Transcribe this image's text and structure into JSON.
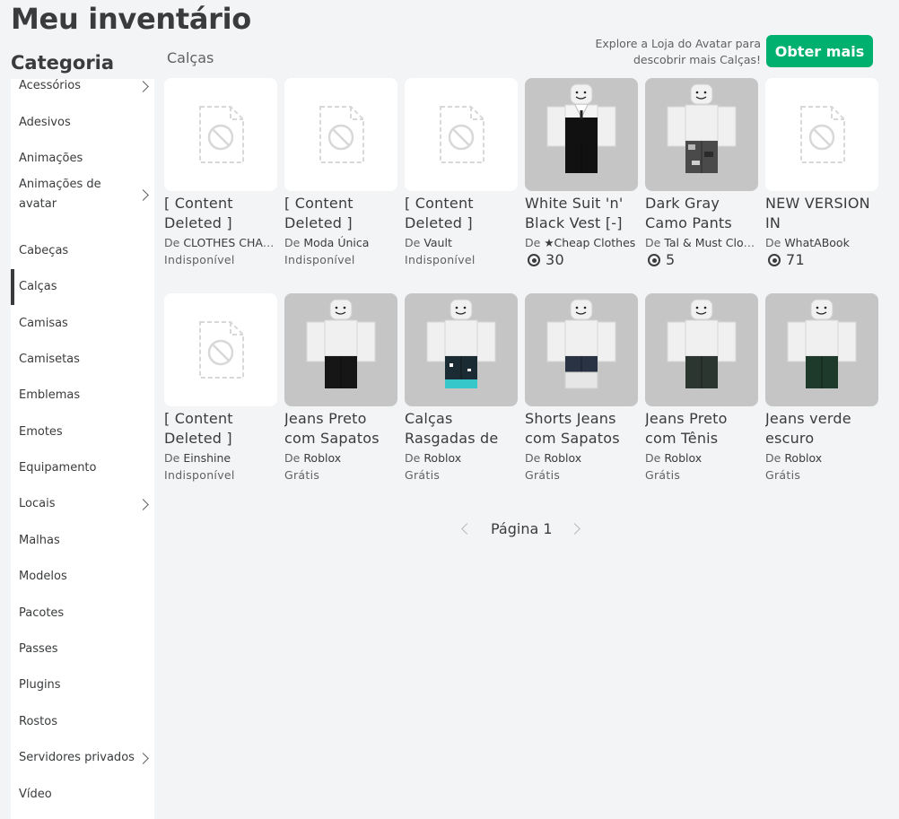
{
  "page": {
    "title": "Meu inventário",
    "category_heading": "Categoria"
  },
  "sidebar": {
    "items": [
      {
        "label": "Acessórios",
        "chevron": true,
        "active": false
      },
      {
        "label": "Adesivos",
        "chevron": false,
        "active": false
      },
      {
        "label": "Animações",
        "chevron": false,
        "active": false
      },
      {
        "label": "Animações de avatar",
        "chevron": true,
        "active": false
      },
      {
        "label": "Cabeças",
        "chevron": false,
        "active": false
      },
      {
        "label": "Calças",
        "chevron": false,
        "active": true
      },
      {
        "label": "Camisas",
        "chevron": false,
        "active": false
      },
      {
        "label": "Camisetas",
        "chevron": false,
        "active": false
      },
      {
        "label": "Emblemas",
        "chevron": false,
        "active": false
      },
      {
        "label": "Emotes",
        "chevron": false,
        "active": false
      },
      {
        "label": "Equipamento",
        "chevron": false,
        "active": false
      },
      {
        "label": "Locais",
        "chevron": true,
        "active": false
      },
      {
        "label": "Malhas",
        "chevron": false,
        "active": false
      },
      {
        "label": "Modelos",
        "chevron": false,
        "active": false
      },
      {
        "label": "Pacotes",
        "chevron": false,
        "active": false
      },
      {
        "label": "Passes",
        "chevron": false,
        "active": false
      },
      {
        "label": "Plugins",
        "chevron": false,
        "active": false
      },
      {
        "label": "Rostos",
        "chevron": false,
        "active": false
      },
      {
        "label": "Servidores privados",
        "chevron": true,
        "active": false
      },
      {
        "label": "Vídeo",
        "chevron": false,
        "active": false
      }
    ]
  },
  "main": {
    "section_label": "Calças",
    "explore_text": "Explore a Loja do Avatar para descobrir mais Calças!",
    "get_more_label": "Obter mais"
  },
  "items": [
    {
      "name": "[ Content Deleted ]",
      "by": "De",
      "creator": "CLOTHES CHAINS",
      "price": "Indisponível",
      "robux": false,
      "thumb": "deleted"
    },
    {
      "name": "[ Content Deleted ]",
      "by": "De",
      "creator": "Moda Única",
      "price": "Indisponível",
      "robux": false,
      "thumb": "deleted"
    },
    {
      "name": "[ Content Deleted ]",
      "by": "De",
      "creator": "Vault",
      "price": "Indisponível",
      "robux": false,
      "thumb": "deleted"
    },
    {
      "name": "White Suit 'n' Black Vest [-]",
      "by": "De",
      "creator": "★Cheap Clothes",
      "price": "30",
      "robux": true,
      "thumb": "suit",
      "color": "#111111"
    },
    {
      "name": "Dark Gray Camo Pants",
      "by": "De",
      "creator": "Tal & Must Clothing",
      "price": "5",
      "robux": true,
      "thumb": "pants",
      "color": "#4a4a4a"
    },
    {
      "name": "NEW VERSION IN",
      "by": "De",
      "creator": "WhatABook",
      "price": "71",
      "robux": true,
      "thumb": "deleted"
    },
    {
      "name": "[ Content Deleted ]",
      "by": "De",
      "creator": "Einshine",
      "price": "Indisponível",
      "robux": false,
      "thumb": "deleted"
    },
    {
      "name": "Jeans Preto com Sapatos",
      "by": "De",
      "creator": "Roblox",
      "price": "Grátis",
      "robux": false,
      "thumb": "pants",
      "color": "#161616"
    },
    {
      "name": "Calças Rasgadas de",
      "by": "De",
      "creator": "Roblox",
      "price": "Grátis",
      "robux": false,
      "thumb": "pants",
      "color": "#1b2b33",
      "accent": "#35c7c9"
    },
    {
      "name": "Shorts Jeans com Sapatos",
      "by": "De",
      "creator": "Roblox",
      "price": "Grátis",
      "robux": false,
      "thumb": "shorts",
      "color": "#2a3344"
    },
    {
      "name": "Jeans Preto com Tênis",
      "by": "De",
      "creator": "Roblox",
      "price": "Grátis",
      "robux": false,
      "thumb": "pants",
      "color": "#2c3630"
    },
    {
      "name": "Jeans verde escuro",
      "by": "De",
      "creator": "Roblox",
      "price": "Grátis",
      "robux": false,
      "thumb": "pants",
      "color": "#1e3a2a"
    }
  ],
  "pagination": {
    "text": "Página 1"
  }
}
